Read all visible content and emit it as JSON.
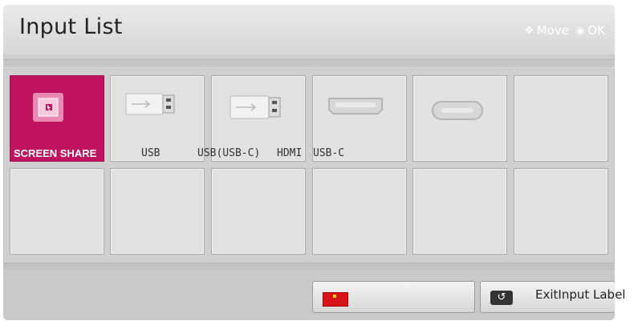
{
  "header": {
    "title": "Input List",
    "hint_move": "Move",
    "hint_ok": "OK",
    "move_icon": "dpad-arrows-icon",
    "ok_icon": "ok-circle-icon"
  },
  "tiles": [
    {
      "label": "SCREEN SHARE",
      "icon": "screen-share-icon",
      "active": true
    },
    {
      "label": "USB",
      "icon": "usb-icon"
    },
    {
      "label": "USB(USB-C)",
      "icon": "usb-icon"
    },
    {
      "label": "HDMI",
      "icon": "hdmi-port-icon"
    },
    {
      "label": "USB-C",
      "icon": "usb-c-port-icon"
    }
  ],
  "footer": {
    "red_button_icon": "red-button-icon",
    "exit_icon": "back-return-icon",
    "exit_text": "ExitInput Label"
  },
  "colors": {
    "active_tile": "#c0135f",
    "panel_bg": "#cfcfcf",
    "red_key": "#d8141b"
  }
}
